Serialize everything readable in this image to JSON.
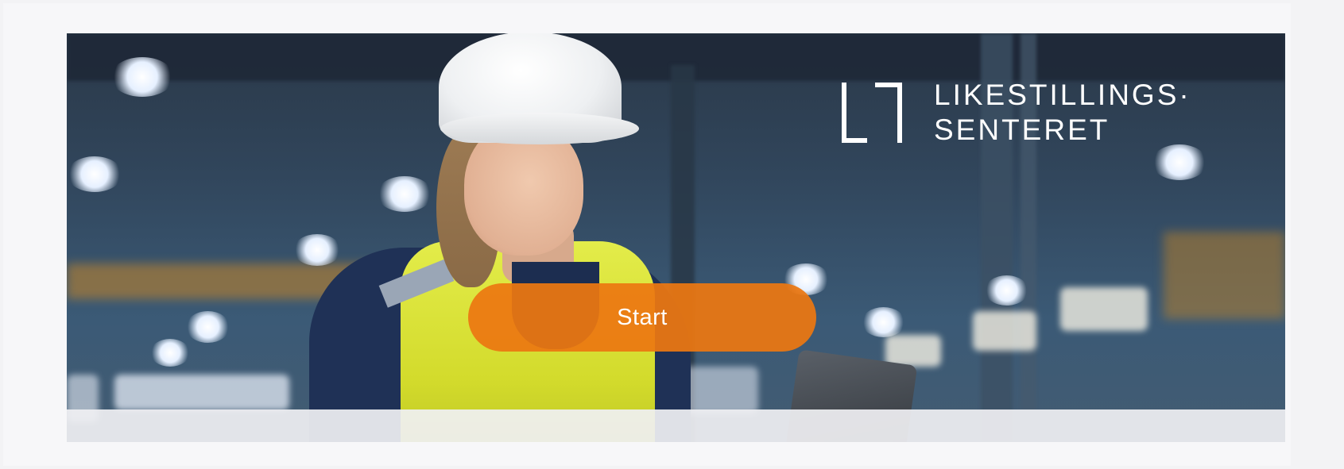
{
  "hero": {
    "image_description_icon": "factory-worker-image",
    "logo": {
      "line1": "LIKESTILLINGS·",
      "line2": "SENTERET"
    },
    "start_button_label": "Start"
  },
  "colors": {
    "accent": "#EC7711",
    "page_background": "#F3F3F5",
    "logo_text": "#FFFFFF"
  }
}
